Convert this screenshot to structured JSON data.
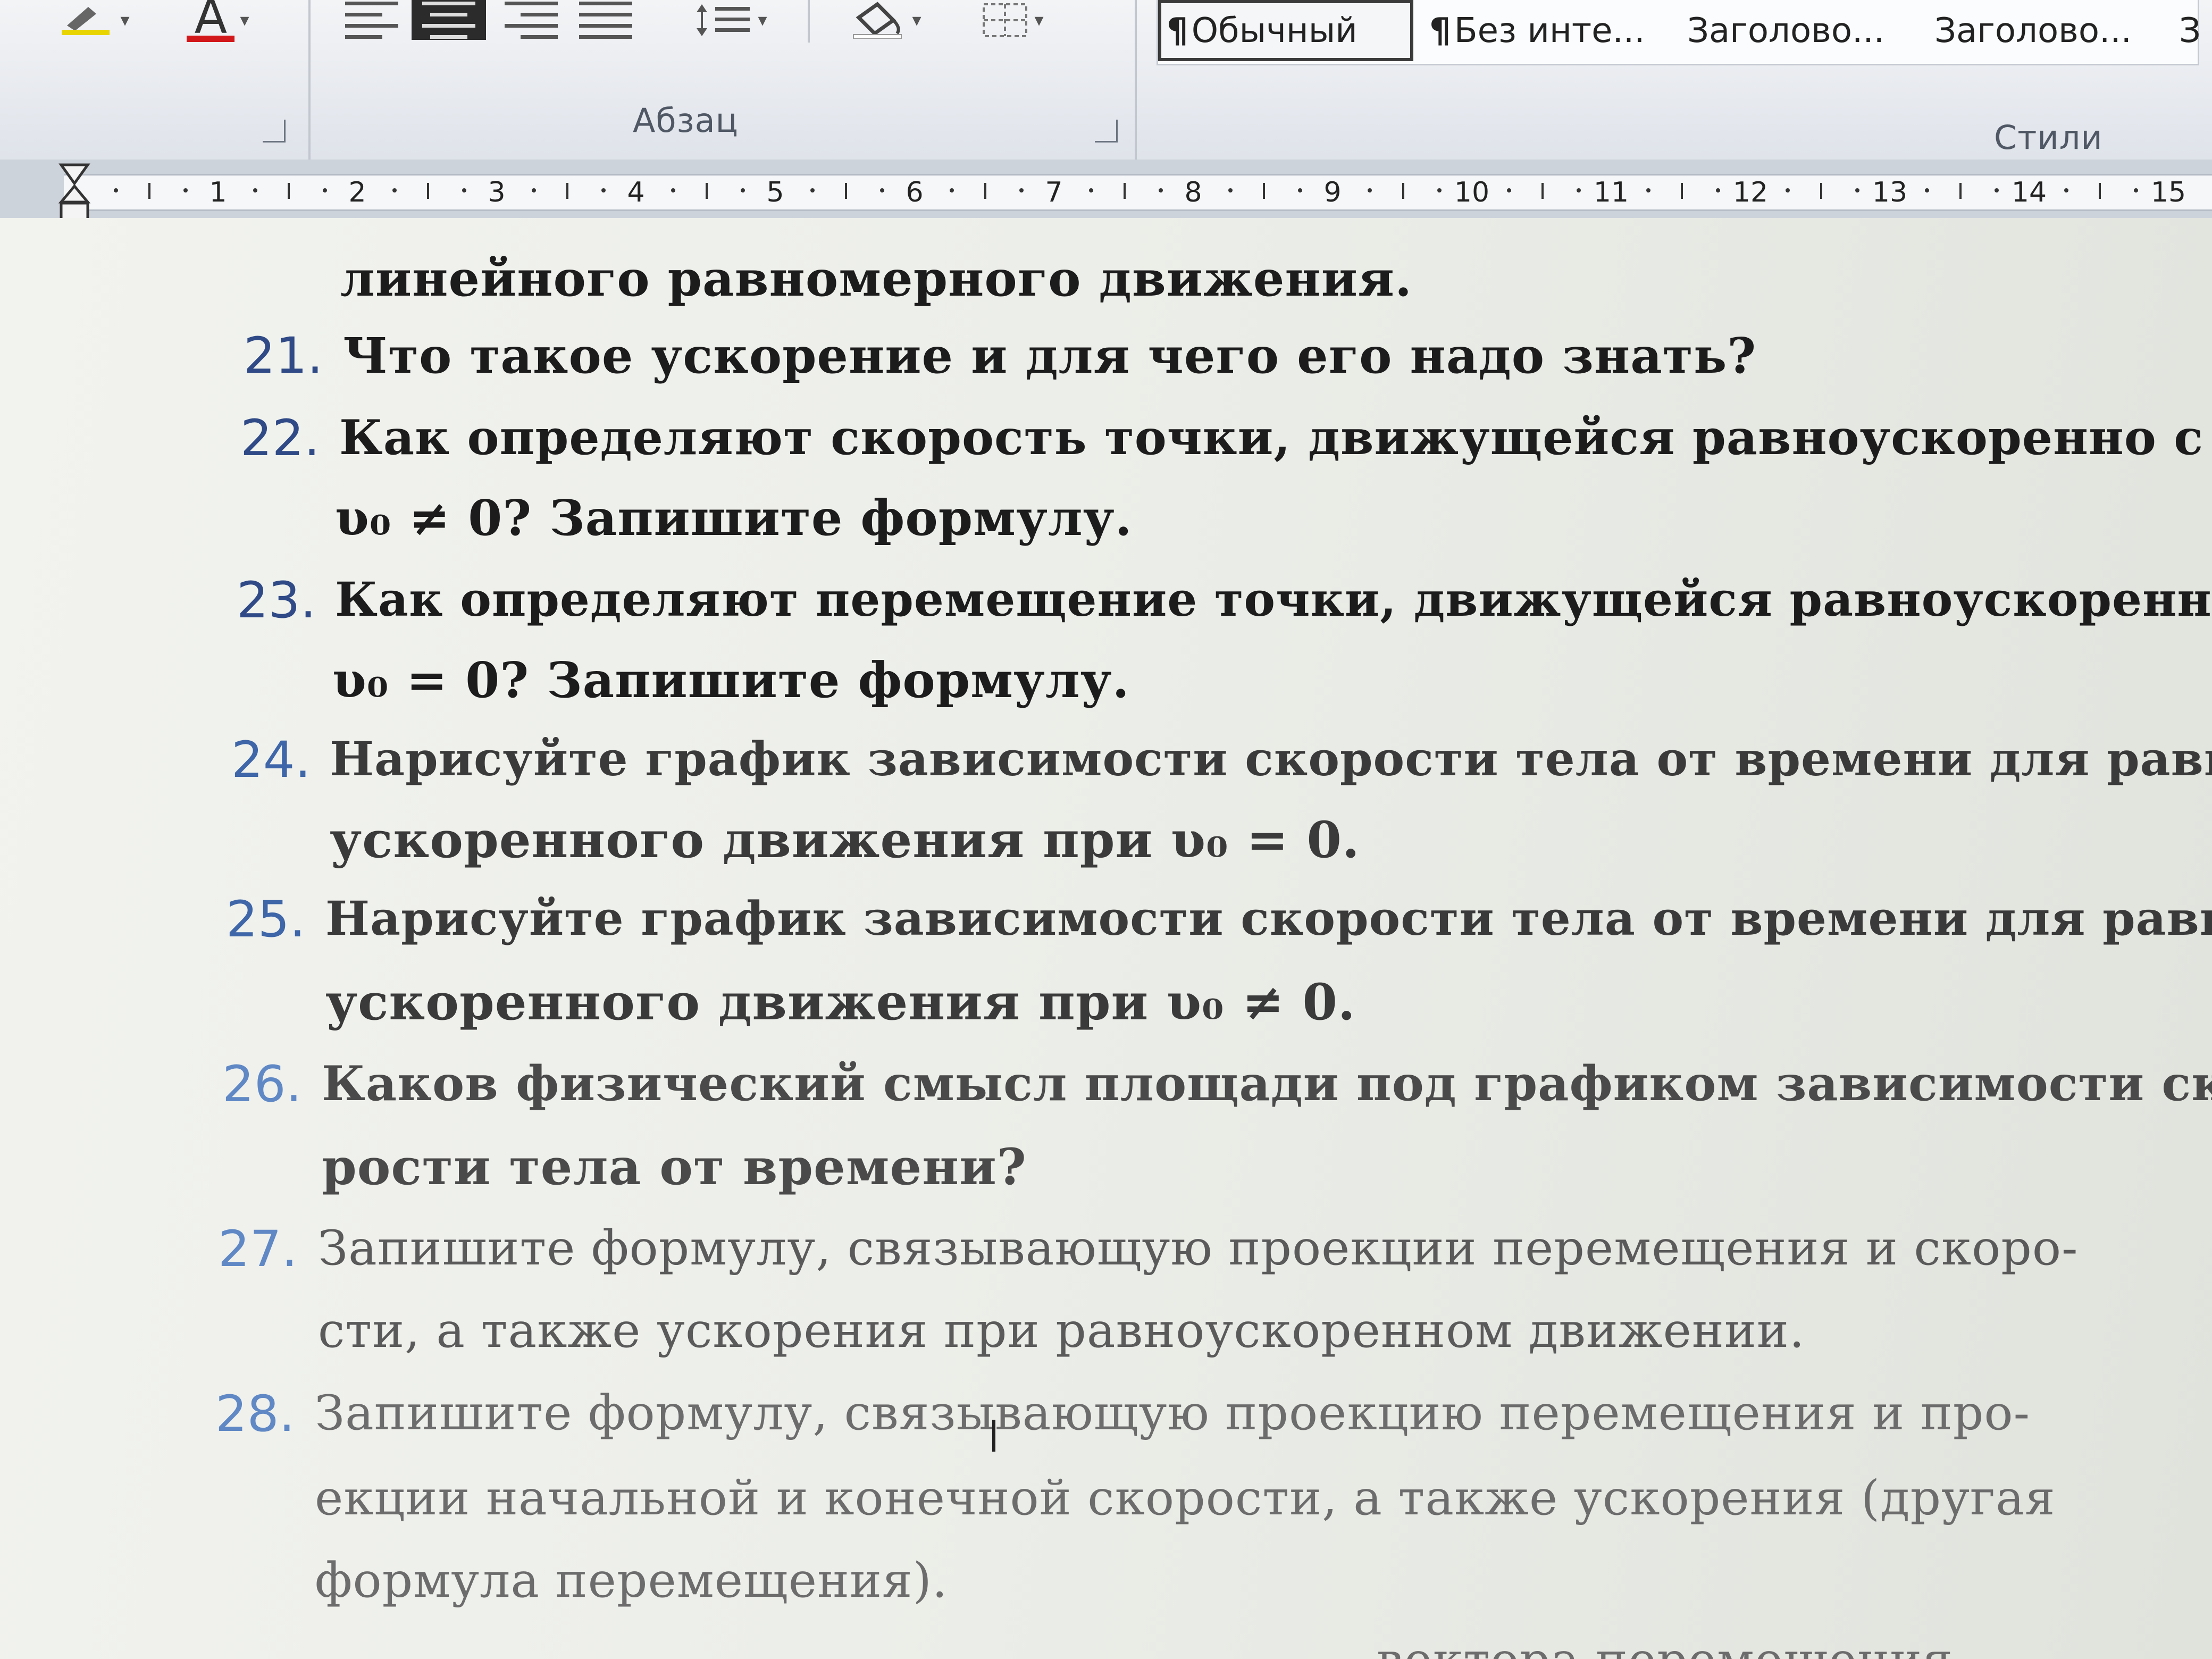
{
  "ribbon": {
    "paragraph_group_label": "Абзац",
    "styles_group_label": "Стили",
    "font_color_letter": "A",
    "styles": [
      {
        "label": "Обычный",
        "marker": "¶"
      },
      {
        "label": "Без инте...",
        "marker": "¶"
      },
      {
        "label": "Заголово..."
      },
      {
        "label": "Заголово..."
      },
      {
        "label": "З"
      }
    ]
  },
  "ruler": {
    "numbers": [
      "1",
      "2",
      "3",
      "4",
      "5",
      "6",
      "7",
      "8",
      "9",
      "10",
      "11",
      "12",
      "13",
      "14",
      "15"
    ]
  },
  "document": {
    "lines": [
      {
        "text": "линейного равномерного движения."
      },
      {
        "num": "21.",
        "text": "Что такое ускорение и для чего его надо знать?"
      },
      {
        "num": "22.",
        "text": "Как  определяют  скорость  точки,  движущейся  равноускоренно  с"
      },
      {
        "text": "υ₀ ≠ 0? Запишите формулу."
      },
      {
        "num": "23.",
        "text": "Как определяют перемещение точки, движущейся равноускоренно с"
      },
      {
        "text": "υ₀ = 0? Запишите формулу."
      },
      {
        "num": "24.",
        "text": "Нарисуйте график зависимости скорости тела от времени для равно-"
      },
      {
        "text": "ускоренного движения при υ₀ = 0."
      },
      {
        "num": "25.",
        "text": "Нарисуйте график зависимости скорости тела от времени для равно-"
      },
      {
        "text": "ускоренного движения при υ₀ ≠ 0."
      },
      {
        "num": "26.",
        "text": "Каков физический смысл площади под графиком зависимости ско-"
      },
      {
        "text": "рости тела от времени?"
      },
      {
        "num": "27.",
        "text": "Запишите формулу, связывающую проекции перемещения и скоро-"
      },
      {
        "text": "сти, а также ускорения при равноускоренном движении."
      },
      {
        "num": "28.",
        "text": "Запишите формулу, связывающую проекцию перемещения и про-"
      },
      {
        "text": "екции начальной и конечной скорости, а также ускорения (другая"
      },
      {
        "text": "формула перемещения)."
      },
      {
        "text": "...вектора перемещения"
      }
    ]
  },
  "colors": {
    "number_blue": "#2f4a86",
    "ribbon_bg": "#e9ecf0",
    "page_bg": "#eceee9"
  }
}
